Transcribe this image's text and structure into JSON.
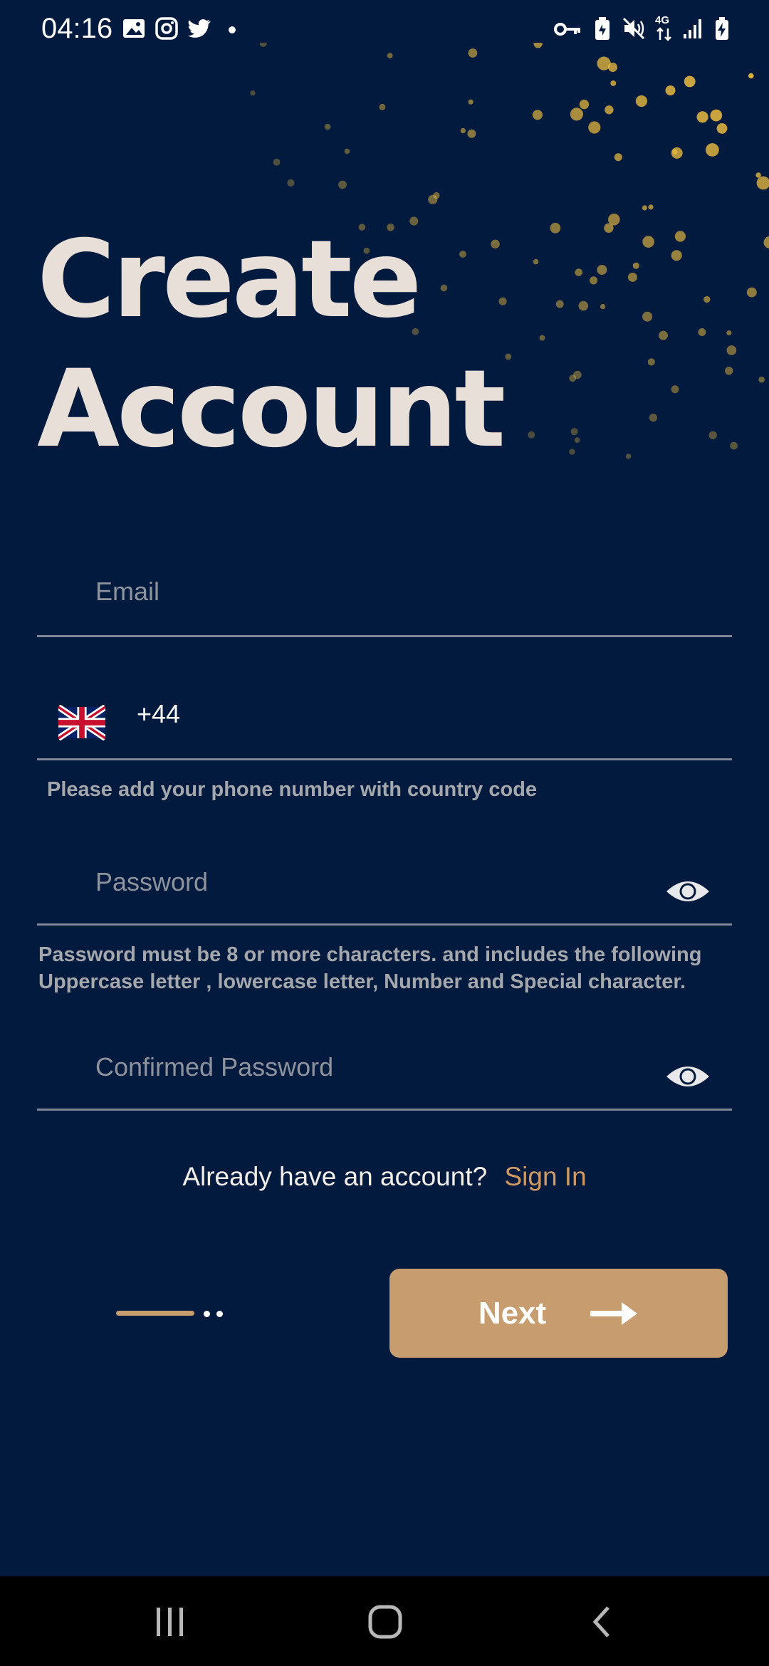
{
  "status_bar": {
    "time": "04:16",
    "left_icons": [
      "gallery-icon",
      "instagram-icon",
      "twitter-icon",
      "notification-dot-icon"
    ],
    "right_icons": [
      "vpn-key-icon",
      "battery-saver-icon",
      "mute-icon",
      "network-4g-icon",
      "signal-icon",
      "battery-charging-icon"
    ],
    "network_label": "4G"
  },
  "heading": {
    "line1": "Create",
    "line2": "Account"
  },
  "form": {
    "email": {
      "placeholder": "Email",
      "value": ""
    },
    "phone": {
      "country_flag": "uk-flag-icon",
      "dial_code": "+44",
      "value": ""
    },
    "phone_helper": "Please add your phone number with country code",
    "password": {
      "placeholder": "Password",
      "value": ""
    },
    "password_helper": "Password must be 8 or more characters. and includes the following Uppercase letter , lowercase letter, Number and Special character.",
    "confirm_password": {
      "placeholder": "Confirmed Password",
      "value": ""
    }
  },
  "signin": {
    "prompt": "Already have an account?",
    "link": "Sign In"
  },
  "pager": {
    "current": 1,
    "total": 3
  },
  "next_button": {
    "label": "Next",
    "icon": "arrow-right-icon"
  },
  "nav_bar": {
    "icons": [
      "recent-apps-icon",
      "home-icon",
      "back-icon"
    ]
  },
  "colors": {
    "background": "#021a3d",
    "accent": "#c79c6e",
    "link": "#d09a64",
    "heading": "#e8e0d8",
    "dots": "#e6b840"
  }
}
